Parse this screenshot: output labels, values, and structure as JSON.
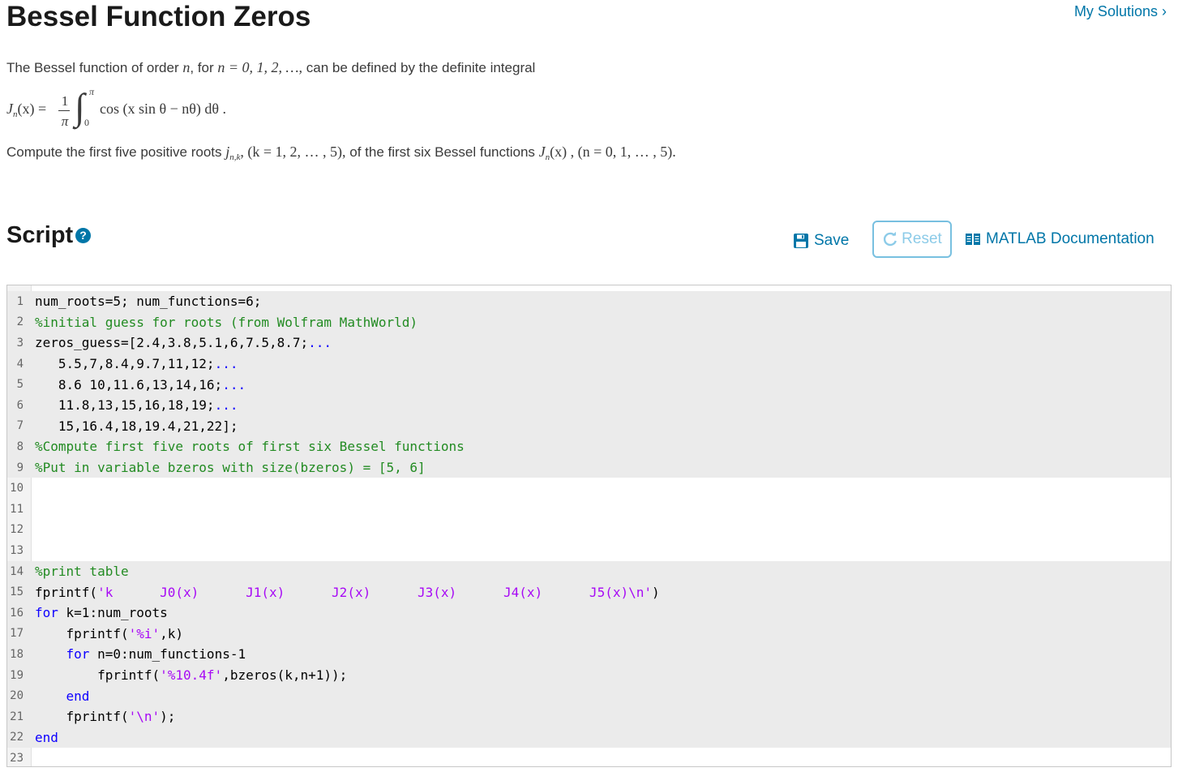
{
  "header": {
    "title": "Bessel Function Zeros",
    "my_solutions": "My Solutions"
  },
  "problem": {
    "intro_1": "The Bessel function of order ",
    "intro_n": "n",
    "intro_2": ", for ",
    "intro_eq": "n = 0, 1, 2, …,",
    "intro_3": " can be defined by the definite integral",
    "formula_lhs": "J",
    "formula_lhs_sub": "n",
    "formula_lhs_arg": "(x) =",
    "formula_num": "1",
    "formula_den": "π",
    "formula_upper": "π",
    "formula_lower": "0",
    "formula_body": "cos (x sin θ − nθ) dθ .",
    "task_1": "Compute the first five positive roots ",
    "task_j": "j",
    "task_j_sub": "n,k",
    "task_2": ", (k = 1, 2, … , 5),",
    "task_3": " of the first six Bessel functions ",
    "task_J": "J",
    "task_J_sub": "n",
    "task_4": "(x) , (n = 0, 1, … , 5)."
  },
  "script": {
    "heading": "Script",
    "help": "?",
    "save_label": "Save",
    "reset_label": "Reset",
    "doc_label": "MATLAB Documentation"
  },
  "editor": {
    "lines": [
      {
        "n": "1",
        "ro": true,
        "tokens": [
          [
            "num_roots=5; num_functions=6;",
            ""
          ]
        ]
      },
      {
        "n": "2",
        "ro": true,
        "tokens": [
          [
            "%initial guess for roots (from Wolfram MathWorld)",
            "cm"
          ]
        ]
      },
      {
        "n": "3",
        "ro": true,
        "tokens": [
          [
            "zeros_guess=[2.4,3.8,5.1,6,7.5,8.7;",
            ""
          ],
          [
            "...",
            "cont"
          ]
        ]
      },
      {
        "n": "4",
        "ro": true,
        "tokens": [
          [
            "   5.5,7,8.4,9.7,11,12;",
            ""
          ],
          [
            "...",
            "cont"
          ]
        ]
      },
      {
        "n": "5",
        "ro": true,
        "tokens": [
          [
            "   8.6 10,11.6,13,14,16;",
            ""
          ],
          [
            "...",
            "cont"
          ]
        ]
      },
      {
        "n": "6",
        "ro": true,
        "tokens": [
          [
            "   11.8,13,15,16,18,19;",
            ""
          ],
          [
            "...",
            "cont"
          ]
        ]
      },
      {
        "n": "7",
        "ro": true,
        "tokens": [
          [
            "   15,16.4,18,19.4,21,22];",
            ""
          ]
        ]
      },
      {
        "n": "8",
        "ro": true,
        "tokens": [
          [
            "%Compute first five roots of first six Bessel functions",
            "cm"
          ]
        ]
      },
      {
        "n": "9",
        "ro": true,
        "tokens": [
          [
            "%Put in variable bzeros with size(bzeros) = [5, 6]",
            "cm"
          ]
        ]
      },
      {
        "n": "10",
        "ro": false,
        "tokens": []
      },
      {
        "n": "11",
        "ro": false,
        "tokens": []
      },
      {
        "n": "12",
        "ro": false,
        "tokens": []
      },
      {
        "n": "13",
        "ro": false,
        "tokens": []
      },
      {
        "n": "14",
        "ro": true,
        "tokens": [
          [
            "%print table",
            "cm"
          ]
        ]
      },
      {
        "n": "15",
        "ro": true,
        "tokens": [
          [
            "fprintf(",
            ""
          ],
          [
            "'k      J0(x)      J1(x)      J2(x)      J3(x)      J4(x)      J5(x)\\n'",
            "str"
          ],
          [
            ")",
            ""
          ]
        ]
      },
      {
        "n": "16",
        "ro": true,
        "tokens": [
          [
            "for",
            "kw"
          ],
          [
            " k=1:num_roots",
            ""
          ]
        ]
      },
      {
        "n": "17",
        "ro": true,
        "tokens": [
          [
            "    fprintf(",
            ""
          ],
          [
            "'%i'",
            "str"
          ],
          [
            ",k)",
            ""
          ]
        ]
      },
      {
        "n": "18",
        "ro": true,
        "tokens": [
          [
            "    ",
            ""
          ],
          [
            "for",
            "kw"
          ],
          [
            " n=0:num_functions-1",
            ""
          ]
        ]
      },
      {
        "n": "19",
        "ro": true,
        "tokens": [
          [
            "        fprintf(",
            ""
          ],
          [
            "'%10.4f'",
            "str"
          ],
          [
            ",bzeros(k,n+1));",
            ""
          ]
        ]
      },
      {
        "n": "20",
        "ro": true,
        "tokens": [
          [
            "    ",
            ""
          ],
          [
            "end",
            "kw"
          ]
        ]
      },
      {
        "n": "21",
        "ro": true,
        "tokens": [
          [
            "    fprintf(",
            ""
          ],
          [
            "'\\n'",
            "str"
          ],
          [
            ");",
            ""
          ]
        ]
      },
      {
        "n": "22",
        "ro": true,
        "tokens": [
          [
            "end",
            "kw"
          ]
        ]
      },
      {
        "n": "23",
        "ro": false,
        "tokens": []
      }
    ]
  },
  "colors": {
    "link": "#0076a8",
    "keyword": "#0e00ff",
    "comment": "#228b22",
    "string": "#a709f5"
  }
}
